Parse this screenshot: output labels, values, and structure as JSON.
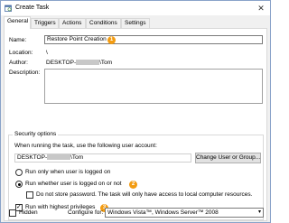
{
  "window": {
    "title": "Create Task",
    "close_glyph": "✕"
  },
  "tabs": [
    {
      "label": "General",
      "active": true
    },
    {
      "label": "Triggers"
    },
    {
      "label": "Actions"
    },
    {
      "label": "Conditions"
    },
    {
      "label": "Settings"
    }
  ],
  "general": {
    "name_label": "Name:",
    "name_value": "Restore Point Creation",
    "location_label": "Location:",
    "location_value": "\\",
    "author_label": "Author:",
    "author_prefix": "DESKTOP-",
    "author_suffix": "\\Tom",
    "description_label": "Description:",
    "description_value": ""
  },
  "security": {
    "group_title": "Security options",
    "account_prompt": "When running the task, use the following user account:",
    "account_prefix": "DESKTOP-",
    "account_suffix": "\\Tom",
    "change_button": "Change User or Group...",
    "run_only_logged_on": "Run only when user is logged on",
    "run_whether_logged_on": "Run whether user is logged on or not",
    "do_not_store_password": "Do not store password.  The task will only have access to local computer resources.",
    "run_highest": "Run with highest privileges"
  },
  "footer": {
    "hidden_label": "Hidden",
    "configure_label": "Configure for:",
    "configure_value": "Windows Vista™, Windows Server™ 2008"
  },
  "badges": {
    "one": "1",
    "two": "2",
    "three": "3"
  },
  "colors": {
    "badge": "#f39c12",
    "border": "#7a7a7a"
  }
}
